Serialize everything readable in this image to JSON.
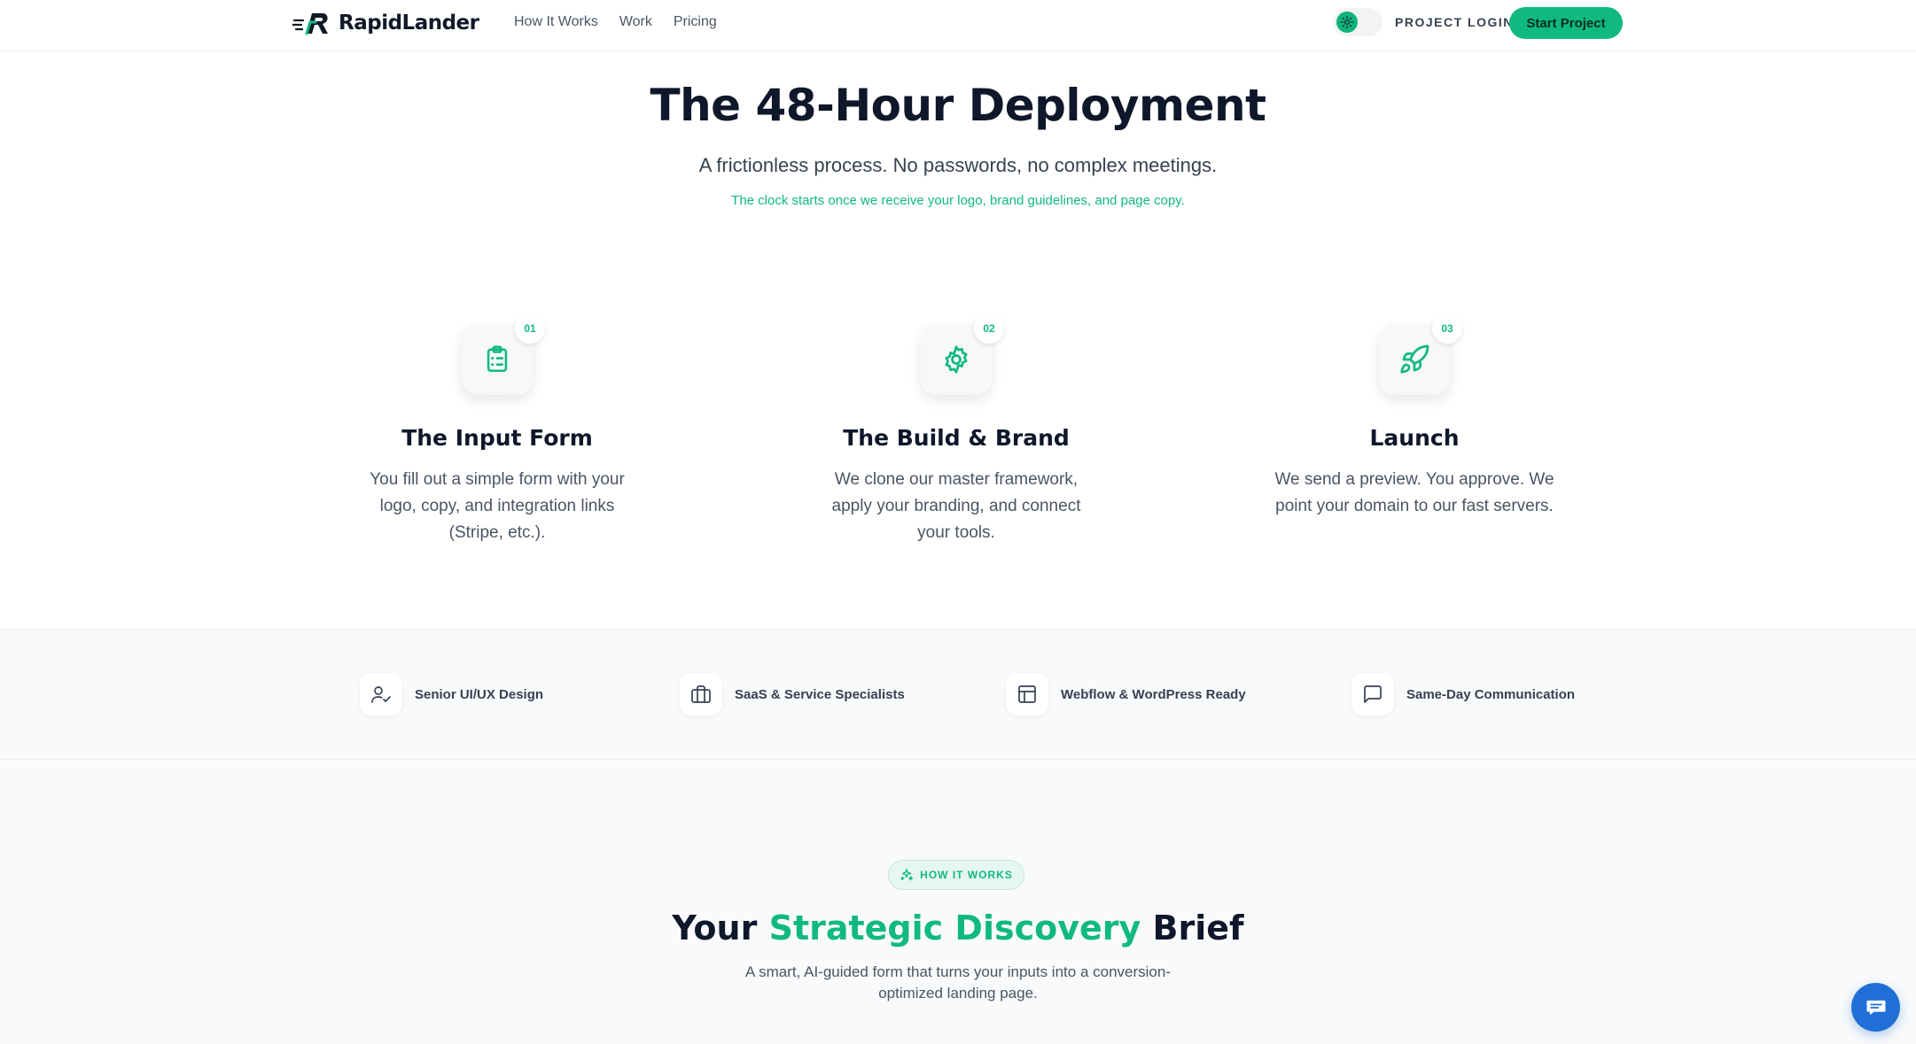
{
  "brand": {
    "name": "RapidLander",
    "primary": "#10b981",
    "dark": "#0f172a"
  },
  "nav": {
    "links": [
      "How It Works",
      "Work",
      "Pricing"
    ],
    "theme_toggle_icon": "sun-icon",
    "login_label": "PROJECT LOGIN",
    "cta_label": "Start Project"
  },
  "hero": {
    "title": "The 48-Hour Deployment",
    "subtitle": "A frictionless process. No passwords, no complex meetings.",
    "note": "The clock starts once we receive your logo, brand guidelines, and page copy."
  },
  "steps": [
    {
      "number": "01",
      "icon": "clipboard-icon",
      "title": "The Input Form",
      "description": "You fill out a simple form with your logo, copy, and integration links (Stripe, etc.)."
    },
    {
      "number": "02",
      "icon": "gear-icon",
      "title": "The Build & Brand",
      "description": "We clone our master framework, apply your branding, and connect your tools."
    },
    {
      "number": "03",
      "icon": "rocket-icon",
      "title": "Launch",
      "description": "We send a preview. You approve. We point your domain to our fast servers."
    }
  ],
  "features": [
    {
      "icon": "user-check-icon",
      "label": "Senior UI/UX Design"
    },
    {
      "icon": "briefcase-icon",
      "label": "SaaS & Service Specialists"
    },
    {
      "icon": "layout-icon",
      "label": "Webflow & WordPress Ready"
    },
    {
      "icon": "chat-icon",
      "label": "Same-Day Communication"
    }
  ],
  "discovery": {
    "badge": "HOW IT WORKS",
    "badge_icon": "sparkles-icon",
    "title_prefix": "Your",
    "title_accent": "Strategic Discovery",
    "title_suffix": "Brief",
    "description": "A smart, AI-guided form that turns your inputs into a conversion-optimized landing page."
  },
  "chat_widget_icon": "message-icon"
}
